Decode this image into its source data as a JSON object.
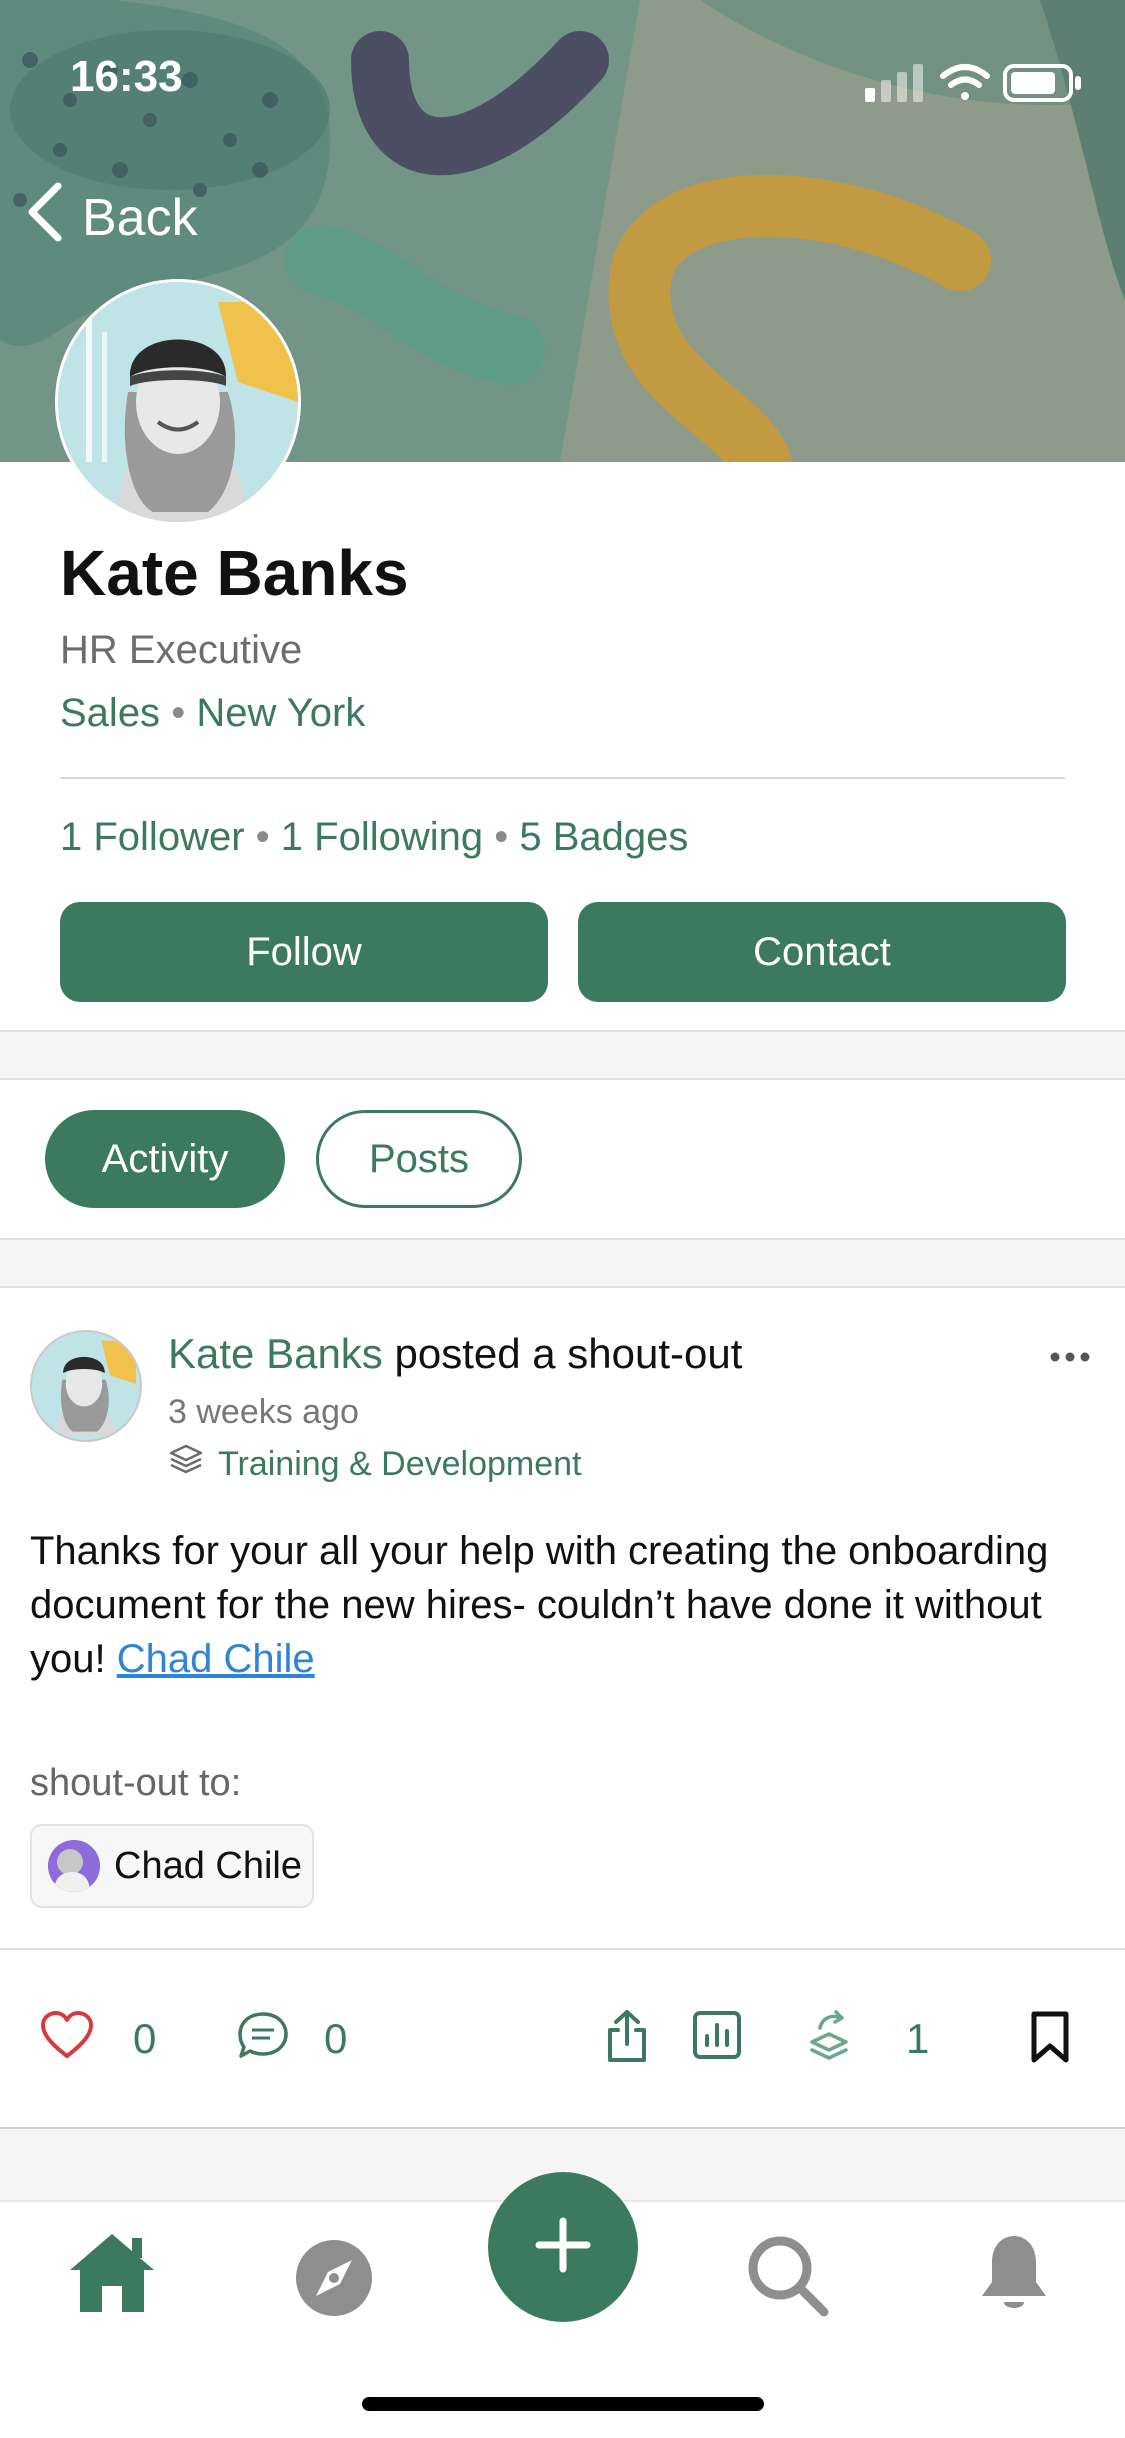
{
  "status_bar": {
    "time": "16:33"
  },
  "nav": {
    "back_label": "Back"
  },
  "profile": {
    "name": "Kate Banks",
    "title": "HR Executive",
    "department": "Sales",
    "location": "New York",
    "separator": "•",
    "followers": "1 Follower",
    "following": "1 Following",
    "badges": "5 Badges",
    "follow_label": "Follow",
    "contact_label": "Contact"
  },
  "tabs": [
    {
      "label": "Activity",
      "active": true
    },
    {
      "label": "Posts",
      "active": false
    }
  ],
  "post": {
    "author": "Kate Banks",
    "action": "posted a shout-out",
    "time": "3 weeks ago",
    "category": "Training & Development",
    "body": "Thanks for your all your help with creating the onboarding document for the new hires- couldn’t have done it without you!",
    "mention": "Chad Chile",
    "shout_out_label": "shout-out to:",
    "shout_out_name": "Chad Chile",
    "likes": "0",
    "comments": "0",
    "reshares": "1"
  },
  "bottom_nav": {
    "items": [
      "home-icon",
      "explore-icon",
      "add-icon",
      "search-icon",
      "notifications-icon"
    ],
    "active": "home-icon"
  },
  "colors": {
    "accent": "#3b7a5f",
    "link": "#2d84d9",
    "like": "#d63b3b"
  }
}
